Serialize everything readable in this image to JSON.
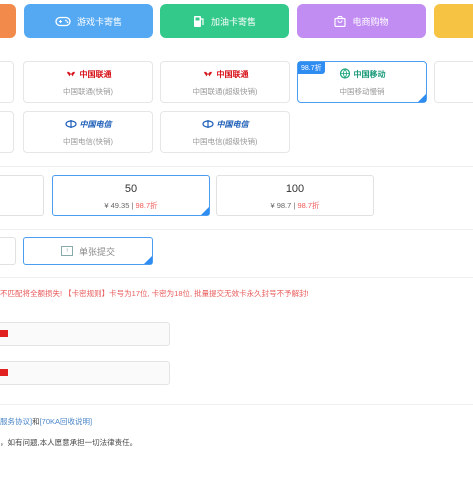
{
  "categories": [
    {
      "label": "",
      "icon": "card-icon"
    },
    {
      "label": "游戏卡寄售",
      "icon": "gamepad-icon"
    },
    {
      "label": "加油卡寄售",
      "icon": "fuel-pump-icon"
    },
    {
      "label": "电商购物",
      "icon": "shopping-bag-icon"
    },
    {
      "label": "",
      "icon": "more-icon"
    }
  ],
  "operators": [
    {
      "brand": "中国联通",
      "sub": "中国联通(快销)",
      "logo": "china-unicom-logo"
    },
    {
      "brand": "中国联通",
      "sub": "中国联通(超级快销)",
      "logo": "china-unicom-logo"
    },
    {
      "brand": "中国移动",
      "sub": "中国移动慢销",
      "logo": "china-mobile-logo",
      "discount": "98.7折",
      "selected": true
    },
    {
      "brand": "中国电信",
      "sub": "中国电信(快销)",
      "logo": "china-telecom-logo"
    },
    {
      "brand": "中国电信",
      "sub": "中国电信(超级快销)",
      "logo": "china-telecom-logo"
    }
  ],
  "denominations": [
    {
      "amount": "50",
      "price": "¥ 49.35 |",
      "discount": "98.7折",
      "selected": true
    },
    {
      "amount": "100",
      "price": "¥ 98.7 |",
      "discount": "98.7折"
    }
  ],
  "submit_mode": {
    "label": "单张提交",
    "icon": "single-card-icon"
  },
  "warning": "不匹配将全额损失! 【卡密规则】卡号为17位, 卡密为18位, 批量提交无效卡永久封号不予解封!",
  "links": {
    "agreement": "服务协议]",
    "and": "和",
    "explain": "[70KA回收说明]"
  },
  "note": "，如有问题,本人愿意承担一切法律责任。",
  "colors": {
    "accent": "#2f8cf0",
    "warning": "#e85a5a"
  }
}
